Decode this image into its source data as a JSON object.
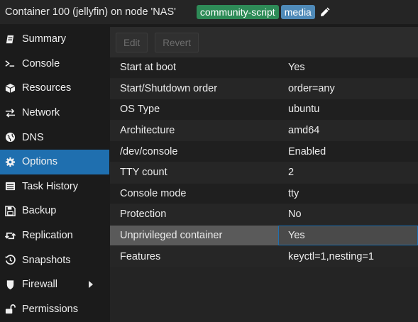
{
  "header": {
    "title": "Container 100 (jellyfin) on node 'NAS'",
    "tags": [
      "community-script",
      "media"
    ],
    "edit_icon": "pencil-icon"
  },
  "sidebar": {
    "items": [
      {
        "label": "Summary",
        "icon": "summary-icon"
      },
      {
        "label": "Console",
        "icon": "terminal-icon"
      },
      {
        "label": "Resources",
        "icon": "cube-icon"
      },
      {
        "label": "Network",
        "icon": "exchange-icon"
      },
      {
        "label": "DNS",
        "icon": "globe-icon"
      },
      {
        "label": "Options",
        "icon": "gear-icon",
        "active": true
      },
      {
        "label": "Task History",
        "icon": "list-icon"
      },
      {
        "label": "Backup",
        "icon": "floppy-icon"
      },
      {
        "label": "Replication",
        "icon": "retweet-icon"
      },
      {
        "label": "Snapshots",
        "icon": "history-icon"
      },
      {
        "label": "Firewall",
        "icon": "shield-icon"
      },
      {
        "label": "Permissions",
        "icon": "unlock-icon"
      }
    ]
  },
  "toolbar": {
    "edit_label": "Edit",
    "revert_label": "Revert"
  },
  "options": {
    "rows": [
      {
        "key": "Start at boot",
        "value": "Yes"
      },
      {
        "key": "Start/Shutdown order",
        "value": "order=any"
      },
      {
        "key": "OS Type",
        "value": "ubuntu"
      },
      {
        "key": "Architecture",
        "value": "amd64"
      },
      {
        "key": "/dev/console",
        "value": "Enabled"
      },
      {
        "key": "TTY count",
        "value": "2"
      },
      {
        "key": "Console mode",
        "value": "tty"
      },
      {
        "key": "Protection",
        "value": "No"
      },
      {
        "key": "Unprivileged container",
        "value": "Yes",
        "selected": true
      },
      {
        "key": "Features",
        "value": "keyctl=1,nesting=1"
      }
    ]
  },
  "colors": {
    "accent": "#1f6faf",
    "tag_green": "#2e8b57",
    "tag_blue": "#4f8ab8"
  }
}
